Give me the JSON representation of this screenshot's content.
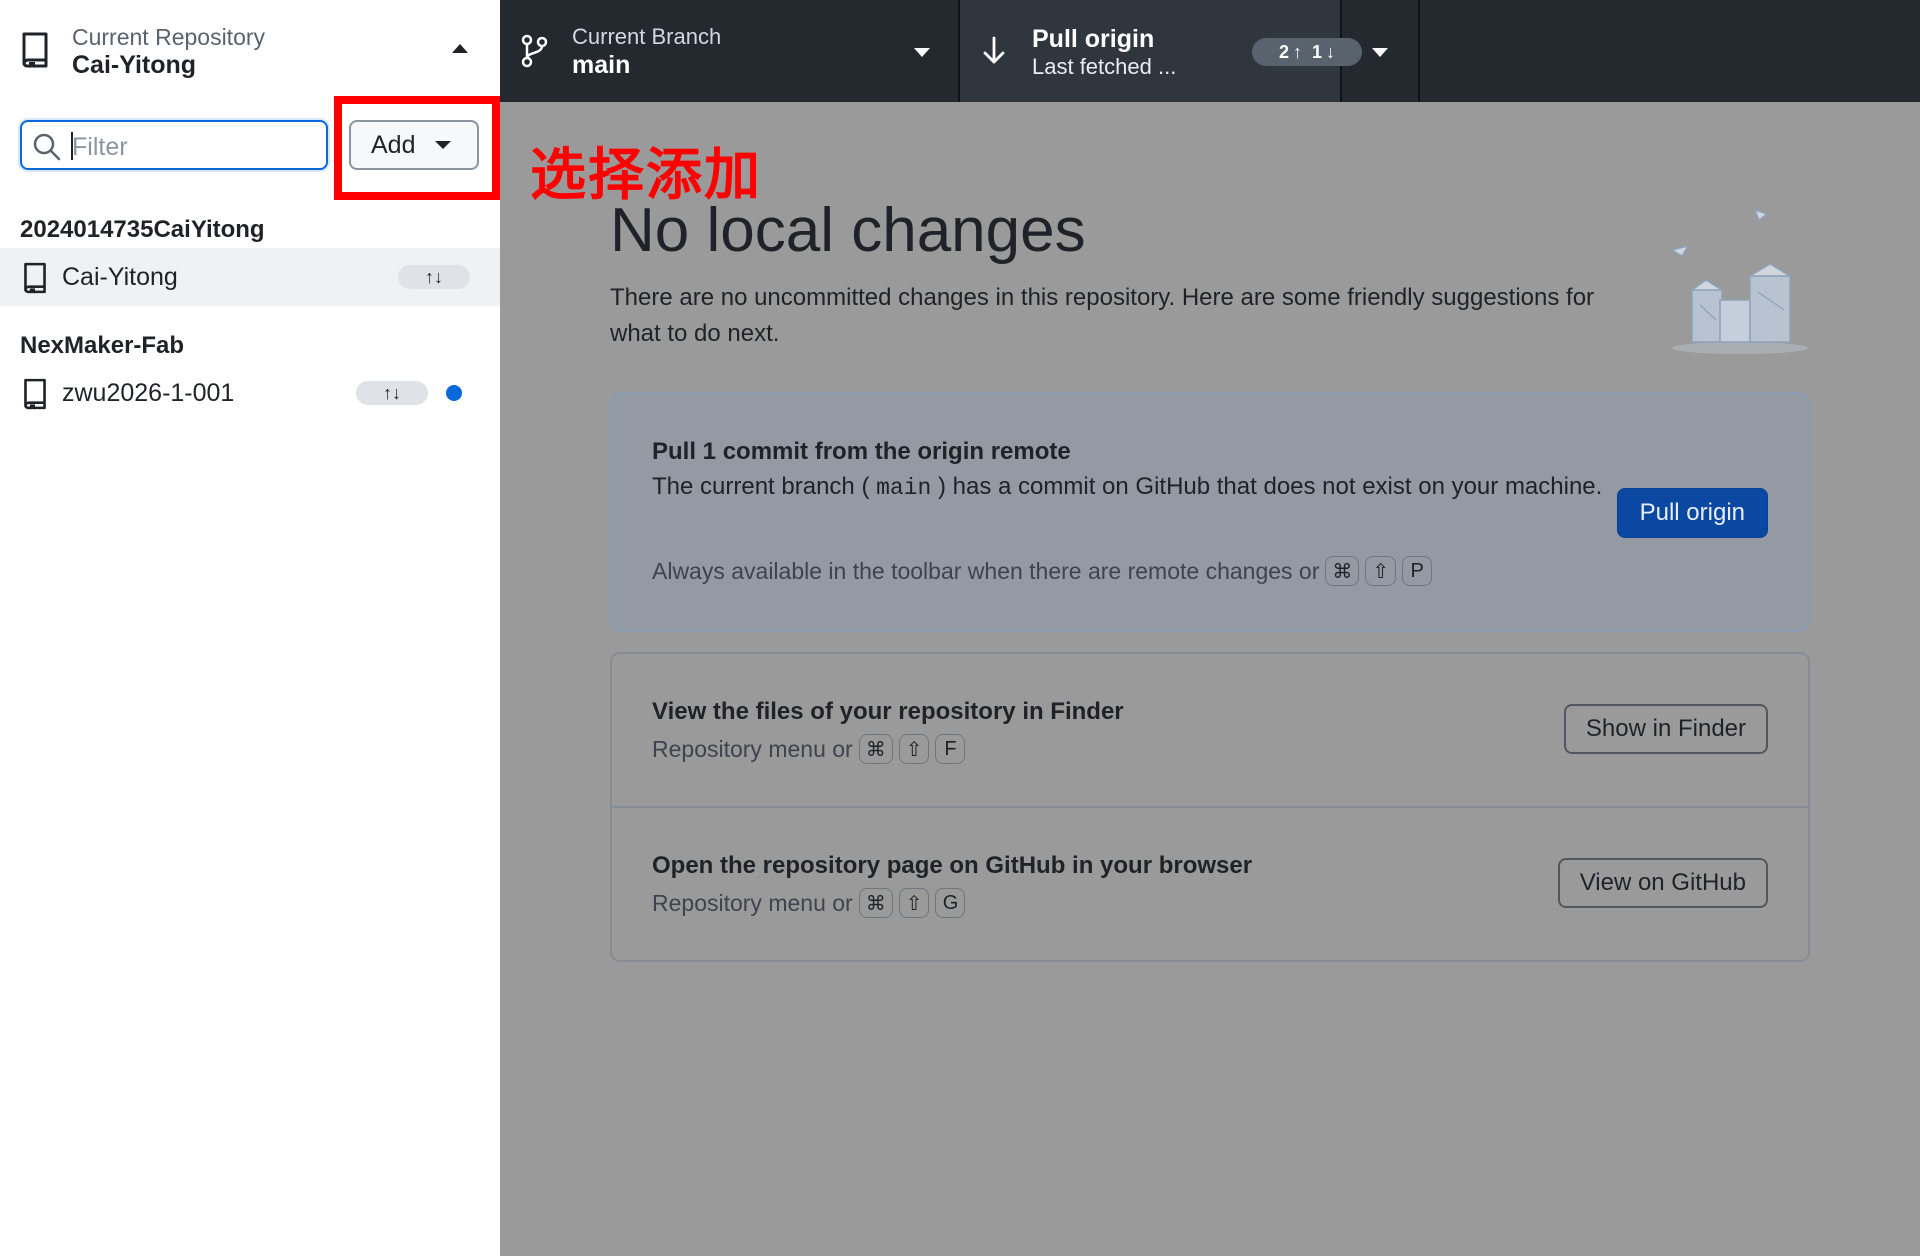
{
  "sidebar": {
    "header": {
      "label": "Current Repository",
      "repository": "Cai-Yitong"
    },
    "filter": {
      "placeholder": "Filter"
    },
    "add_button": {
      "label": "Add"
    },
    "groups": [
      {
        "title": "2024014735CaiYitong",
        "repos": [
          {
            "name": "Cai-Yitong",
            "ahead_behind": "↑↓",
            "selected": true
          }
        ]
      },
      {
        "title": "NexMaker-Fab",
        "repos": [
          {
            "name": "zwu2026-1-001",
            "ahead_behind": "↑↓",
            "has_changes": true
          }
        ]
      }
    ]
  },
  "toolbar": {
    "branch": {
      "label": "Current Branch",
      "name": "main"
    },
    "pull": {
      "label": "Pull origin",
      "sub": "Last fetched ...",
      "ahead": "2",
      "ahead_arrow": "↑",
      "behind": "1",
      "behind_arrow": "↓"
    }
  },
  "annotation": {
    "text": "选择添加",
    "color": "#ff0000"
  },
  "main": {
    "title": "No local changes",
    "description": "There are no uncommitted changes in this repository. Here are some friendly suggestions for what to do next.",
    "pull_card": {
      "title": "Pull 1 commit from the origin remote",
      "text_before": "The current branch (",
      "branch": "main",
      "text_after": ") has a commit on GitHub that does not exist on your machine.",
      "hint": "Always available in the toolbar when there are remote changes or",
      "keys": [
        "⌘",
        "⇧",
        "P"
      ],
      "button": "Pull origin"
    },
    "finder_card": {
      "title": "View the files of your repository in Finder",
      "hint": "Repository menu or",
      "keys": [
        "⌘",
        "⇧",
        "F"
      ],
      "button": "Show in Finder"
    },
    "github_card": {
      "title": "Open the repository page on GitHub in your browser",
      "hint": "Repository menu or",
      "keys": [
        "⌘",
        "⇧",
        "G"
      ],
      "button": "View on GitHub"
    }
  },
  "colors": {
    "accent": "#0969da",
    "primary_button": "#0b48a2",
    "toolbar": "#24292f",
    "overlay": "#9a9a9a",
    "highlight": "#ff0000"
  }
}
